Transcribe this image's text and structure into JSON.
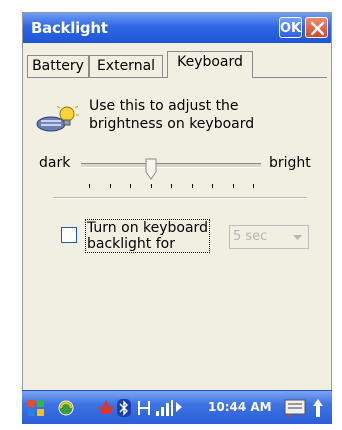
{
  "window": {
    "title": "Backlight",
    "ok_label": "OK"
  },
  "tabs": [
    {
      "label": "Battery",
      "active": false
    },
    {
      "label": "External",
      "active": false
    },
    {
      "label": "Keyboard",
      "active": true
    }
  ],
  "info": {
    "line1": "Use this to adjust the",
    "line2": "brightness on keyboard",
    "icon": "keyboard-lightbulb-icon"
  },
  "slider": {
    "min_label": "dark",
    "max_label": "bright",
    "value_fraction": 0.375,
    "ticks": 9
  },
  "backlight_option": {
    "checked": false,
    "label_line1": "Turn on keyboard",
    "label_line2": "backlight for",
    "timeout_value": "5 sec",
    "enabled": false
  },
  "taskbar": {
    "clock": "10:44 AM",
    "icons": [
      "windows-start-icon",
      "sync-icon",
      "app-icon",
      "bluetooth-icon",
      "connectivity-icon",
      "signal-icon",
      "arrow-right-icon",
      "keyboard-icon",
      "up-arrow-icon"
    ]
  },
  "colors": {
    "titlebar": "#2e67e4",
    "window_bg": "#f1efe2",
    "close": "#d34527"
  }
}
